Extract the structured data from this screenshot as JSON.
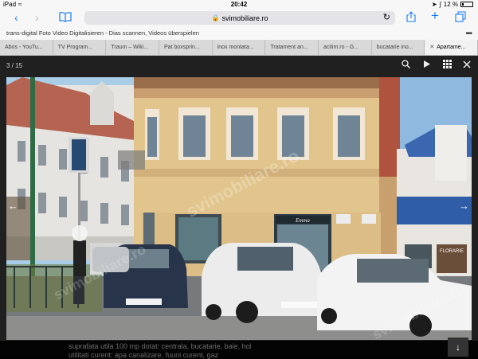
{
  "status": {
    "device": "iPad",
    "time": "20:42",
    "battery": "12 %",
    "battery_level": 0.12
  },
  "browser": {
    "back_icon": "chevron-left-icon",
    "forward_icon": "chevron-right-icon",
    "bookmarks_icon": "book-icon",
    "address": "svimobiliare.ro",
    "page_title": "trans-digital Foto Video Digitalisieren - Dias scannen, Videos überspielen"
  },
  "tabs": [
    {
      "label": "Abos - YouTu..."
    },
    {
      "label": "TV Program..."
    },
    {
      "label": "Traum – Wiki..."
    },
    {
      "label": "Pat boxsprin..."
    },
    {
      "label": "inox montata..."
    },
    {
      "label": "Tratament an..."
    },
    {
      "label": "acitim.ro - G..."
    },
    {
      "label": "bucatarie ino..."
    },
    {
      "label": "Apartame..."
    }
  ],
  "viewer": {
    "counter": "3 / 15",
    "watermark": "svimobiliare.ro",
    "caption_text": "suprafata utila 100 mp  dotat: centrala, bucatarie, baie, hol",
    "caption_text2": "utilitati curent: apa canalizare, fuuni curent, gaz"
  },
  "photo": {
    "shop_sign": "Emma",
    "car_plate_text": "",
    "florarie": "FLORARIE"
  },
  "colors": {
    "sky": "#a9cde6",
    "building": "#e2c58c",
    "building_trim": "#d9a978",
    "roof_blue": "#2f5da8"
  }
}
